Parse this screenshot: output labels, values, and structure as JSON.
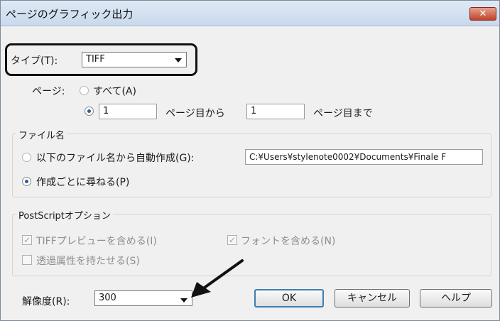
{
  "window": {
    "title": "ページのグラフィック出力",
    "close_label": "✕"
  },
  "type_row": {
    "label": "タイプ(T):",
    "selected": "TIFF"
  },
  "pages": {
    "label": "ページ:",
    "all_option": "すべて(A)",
    "from_value": "1",
    "from_suffix": "ページ目から",
    "to_value": "1",
    "to_suffix": "ページ目まで"
  },
  "filename_group": {
    "legend": "ファイル名",
    "auto_option": "以下のファイル名から自動作成(G):",
    "path_value": "C:¥Users¥stylenote0002¥Documents¥Finale F",
    "ask_option": "作成ごとに尋ねる(P)"
  },
  "postscript_group": {
    "legend": "PostScriptオプション",
    "tiff_preview": "TIFFプレビューを含める(I)",
    "include_fonts": "フォントを含める(N)",
    "transparency": "透過属性を持たせる(S)"
  },
  "resolution": {
    "label": "解像度(R):",
    "value": "300"
  },
  "buttons": {
    "ok": "OK",
    "cancel": "キャンセル",
    "help": "ヘルプ"
  }
}
